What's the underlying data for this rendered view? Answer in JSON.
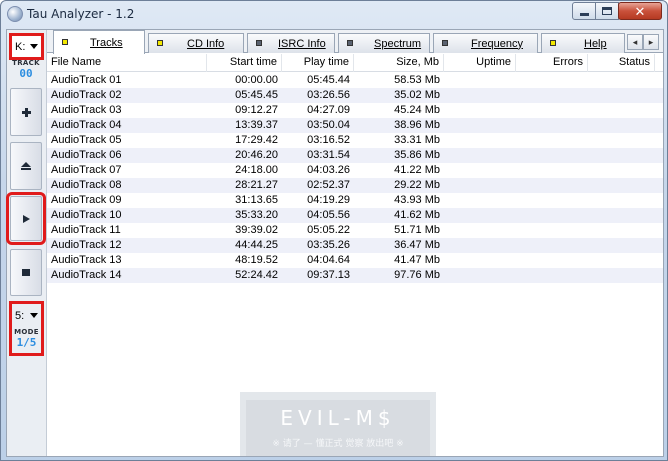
{
  "window": {
    "title": "Tau Analyzer - 1.2",
    "controls": {
      "close_glyph": "✕"
    }
  },
  "toolbar": {
    "drive": {
      "value": "K:"
    },
    "track": {
      "label": "TRACK",
      "value": "00"
    },
    "buttons": [
      {
        "name": "add-button",
        "icon": "plus-icon"
      },
      {
        "name": "eject-button",
        "icon": "eject-icon"
      },
      {
        "name": "play-button",
        "icon": "play-icon"
      },
      {
        "name": "stop-button",
        "icon": "stop-icon"
      }
    ],
    "mode": {
      "value": "5:",
      "label": "MODE",
      "display": "1/5"
    }
  },
  "tabs": [
    {
      "label": "Tracks",
      "icon": "yellow-square-icon",
      "active": true
    },
    {
      "label": "CD Info",
      "icon": "yellow-square-icon",
      "active": false
    },
    {
      "label": "ISRC Info",
      "icon": "gray-square-icon",
      "active": false
    },
    {
      "label": "Spectrum",
      "icon": "gray-square-icon",
      "active": false
    },
    {
      "label": "Frequency",
      "icon": "gray-square-icon",
      "active": false
    },
    {
      "label": "Help",
      "icon": "yellow-square-icon",
      "active": false
    }
  ],
  "tab_scroll": {
    "left": "◂",
    "right": "▸"
  },
  "table": {
    "columns": [
      "File Name",
      "Start time",
      "Play time",
      "Size, Mb",
      "Uptime",
      "Errors",
      "Status"
    ],
    "rows": [
      [
        "AudioTrack 01",
        "00:00.00",
        "05:45.44",
        "58.53 Mb",
        "",
        "",
        ""
      ],
      [
        "AudioTrack 02",
        "05:45.45",
        "03:26.56",
        "35.02 Mb",
        "",
        "",
        ""
      ],
      [
        "AudioTrack 03",
        "09:12.27",
        "04:27.09",
        "45.24 Mb",
        "",
        "",
        ""
      ],
      [
        "AudioTrack 04",
        "13:39.37",
        "03:50.04",
        "38.96 Mb",
        "",
        "",
        ""
      ],
      [
        "AudioTrack 05",
        "17:29.42",
        "03:16.52",
        "33.31 Mb",
        "",
        "",
        ""
      ],
      [
        "AudioTrack 06",
        "20:46.20",
        "03:31.54",
        "35.86 Mb",
        "",
        "",
        ""
      ],
      [
        "AudioTrack 07",
        "24:18.00",
        "04:03.26",
        "41.22 Mb",
        "",
        "",
        ""
      ],
      [
        "AudioTrack 08",
        "28:21.27",
        "02:52.37",
        "29.22 Mb",
        "",
        "",
        ""
      ],
      [
        "AudioTrack 09",
        "31:13.65",
        "04:19.29",
        "43.93 Mb",
        "",
        "",
        ""
      ],
      [
        "AudioTrack 10",
        "35:33.20",
        "04:05.56",
        "41.62 Mb",
        "",
        "",
        ""
      ],
      [
        "AudioTrack 11",
        "39:39.02",
        "05:05.22",
        "51.71 Mb",
        "",
        "",
        ""
      ],
      [
        "AudioTrack 12",
        "44:44.25",
        "03:35.26",
        "36.47 Mb",
        "",
        "",
        ""
      ],
      [
        "AudioTrack 13",
        "48:19.52",
        "04:04.64",
        "41.47 Mb",
        "",
        "",
        ""
      ],
      [
        "AudioTrack 14",
        "52:24.42",
        "09:37.13",
        "97.76 Mb",
        "",
        "",
        ""
      ]
    ]
  },
  "watermark": {
    "title": "EVIL-M$",
    "subtitle": "※ 请了 — 懂正式 觉察 放出吧 ※"
  },
  "colors": {
    "highlight_red": "#e01b1b",
    "lcd_blue": "#2d8ee0",
    "row_stripe": "#eef0f9",
    "tab_yellow": "#f3e800"
  }
}
